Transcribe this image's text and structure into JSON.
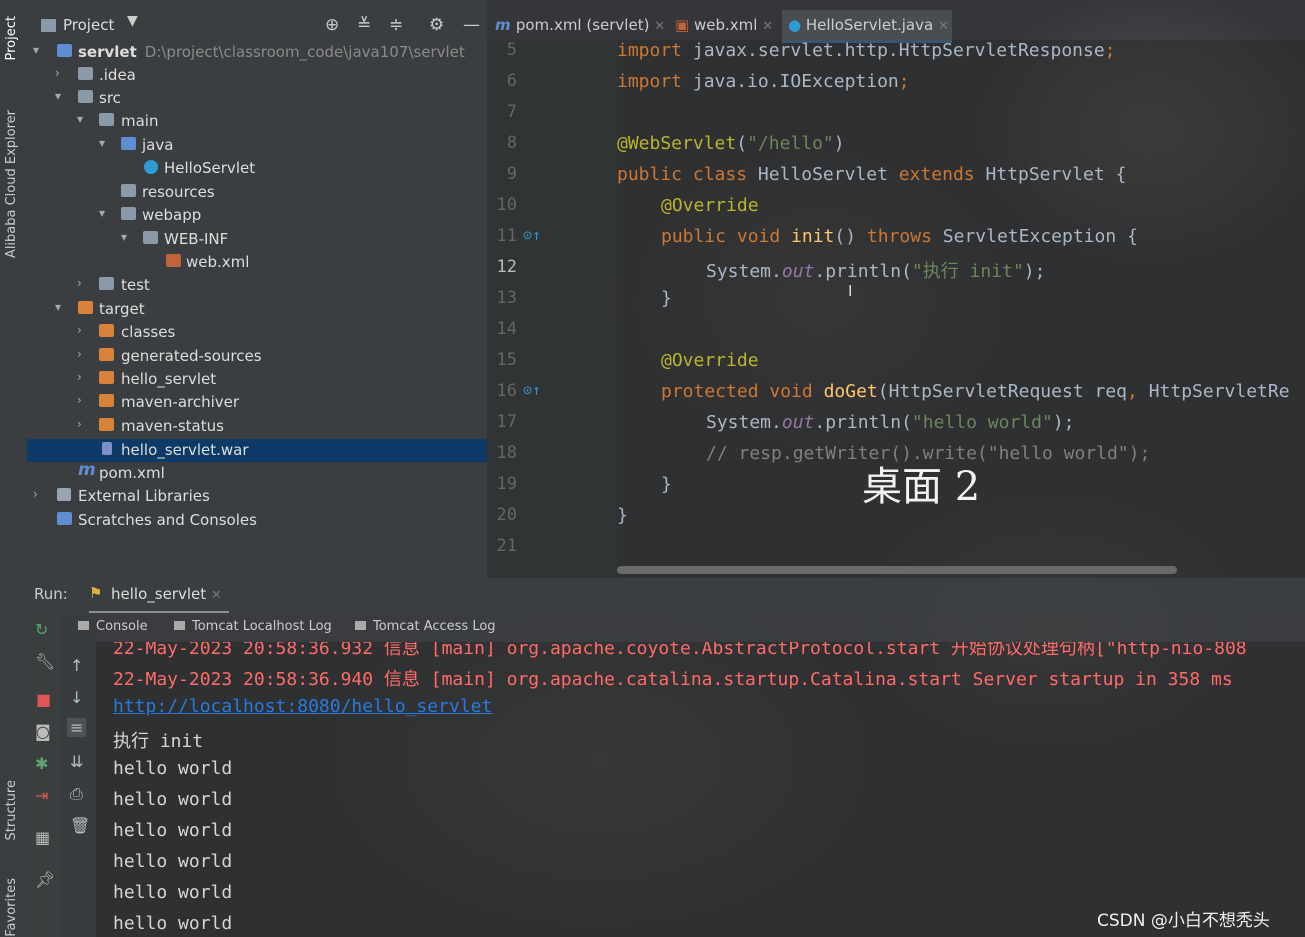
{
  "side_tabs": {
    "project": "Project",
    "alibaba": "Alibaba Cloud Explorer",
    "structure": "Structure",
    "favorites": "Favorites"
  },
  "project_panel": {
    "title": "Project",
    "tree": [
      {
        "label": "servlet",
        "path": "D:\\project\\classroom_code\\java107\\servlet"
      },
      {
        "label": ".idea"
      },
      {
        "label": "src"
      },
      {
        "label": "main"
      },
      {
        "label": "java"
      },
      {
        "label": "HelloServlet"
      },
      {
        "label": "resources"
      },
      {
        "label": "webapp"
      },
      {
        "label": "WEB-INF"
      },
      {
        "label": "web.xml"
      },
      {
        "label": "test"
      },
      {
        "label": "target"
      },
      {
        "label": "classes"
      },
      {
        "label": "generated-sources"
      },
      {
        "label": "hello_servlet"
      },
      {
        "label": "maven-archiver"
      },
      {
        "label": "maven-status"
      },
      {
        "label": "hello_servlet.war"
      },
      {
        "label": "pom.xml"
      },
      {
        "label": "External Libraries"
      },
      {
        "label": "Scratches and Consoles"
      }
    ]
  },
  "editor": {
    "tabs": [
      {
        "label": "pom.xml (servlet)"
      },
      {
        "label": "web.xml"
      },
      {
        "label": "HelloServlet.java"
      }
    ],
    "line_numbers": [
      "5",
      "6",
      "7",
      "8",
      "9",
      "10",
      "11",
      "12",
      "13",
      "14",
      "15",
      "16",
      "17",
      "18",
      "19",
      "20",
      "21"
    ],
    "code": {
      "l5a": "import ",
      "l5b": "javax.servlet.http.HttpServletResponse",
      "l5c": ";",
      "l6a": "import ",
      "l6b": "java.io.IOException",
      "l6c": ";",
      "l8a": "@WebServlet",
      "l8b": "(",
      "l8c": "\"/hello\"",
      "l8d": ")",
      "l9a": "public class ",
      "l9b": "HelloServlet ",
      "l9c": "extends ",
      "l9d": "HttpServlet {",
      "l10": "@Override",
      "l11a": "public void ",
      "l11b": "init",
      "l11c": "() ",
      "l11d": "throws ",
      "l11e": "ServletException {",
      "l12a": "System.",
      "l12b": "out",
      "l12c": ".println(",
      "l12d": "\"执行 init\"",
      "l12e": ");",
      "l13": "}",
      "l15": "@Override",
      "l16a": "protected void ",
      "l16b": "doGet",
      "l16c": "(HttpServletRequest req",
      "l16d": ", ",
      "l16e": "HttpServletRe",
      "l17a": "System.",
      "l17b": "out",
      "l17c": ".println(",
      "l17d": "\"hello world\"",
      "l17e": ");",
      "l18": "// resp.getWriter().write(\"hello world\");",
      "l19": "}",
      "l20": "}"
    },
    "overlay": "桌面 2"
  },
  "run_panel": {
    "label": "Run:",
    "config": "hello_servlet",
    "subtabs": [
      "Console",
      "Tomcat Localhost Log",
      "Tomcat Access Log"
    ],
    "console_lines": {
      "l0": "22-May-2023 20:58:36.932 信息 [main] org.apache.coyote.AbstractProtocol.start 开始协议处理句柄[\"http-nio-808",
      "l1": "22-May-2023 20:58:36.940 信息 [main] org.apache.catalina.startup.Catalina.start Server startup in 358 ms",
      "l2": "http://localhost:8080/hello_servlet",
      "l3": "执行 init",
      "l4": "hello world",
      "l5": "hello world",
      "l6": "hello world",
      "l7": "hello world",
      "l8": "hello world",
      "l9": "hello world"
    }
  },
  "watermark": "CSDN @小白不想秃头"
}
